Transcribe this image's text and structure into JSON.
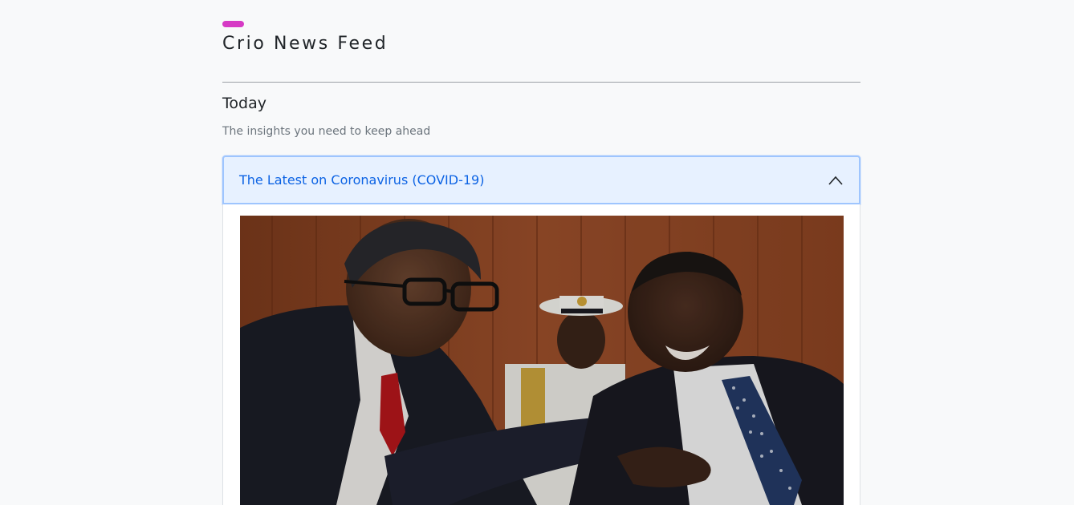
{
  "header": {
    "title": "Crio News Feed",
    "accent_color": "#d63ac5"
  },
  "section": {
    "heading": "Today",
    "subtitle": "The insights you need to keep ahead"
  },
  "accordion": {
    "items": [
      {
        "title": "The Latest on Coronavirus (COVID-19)",
        "expanded": true,
        "toggle_icon": "chevron-up-icon",
        "image_alt": "Two men in suits sharing hand sanitizer, an officer in white uniform seated behind them"
      }
    ],
    "header_bg": "#e7f1ff",
    "title_color": "#0c63e4"
  }
}
